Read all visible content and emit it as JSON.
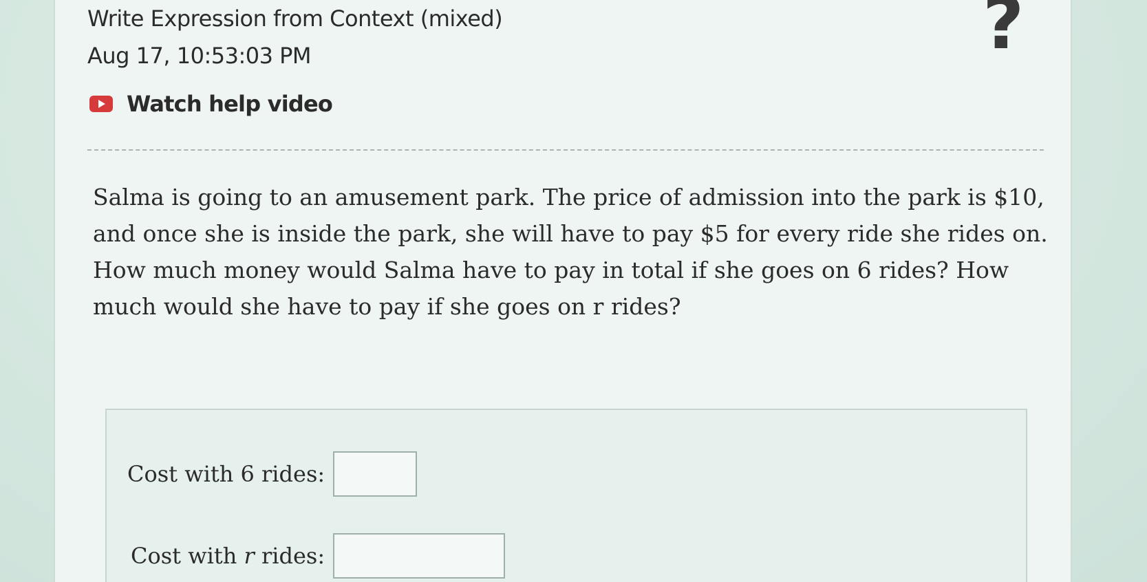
{
  "header": {
    "title": "Write Expression from Context (mixed)",
    "timestamp": "Aug 17, 10:53:03 PM",
    "help_link": "Watch help video",
    "help_icon": "play-video-icon",
    "question_mark": "?"
  },
  "problem": {
    "text": "Salma is going to an amusement park. The price of admission into the park is $10, and once she is inside the park, she will have to pay $5 for every ride she rides on. How much money would Salma have to pay in total if she goes on 6 rides? How much would she have to pay if she goes on r rides?"
  },
  "answers": {
    "cost_6_label": "Cost with 6 rides:",
    "cost_6_value": "",
    "cost_r_label_prefix": "Cost with",
    "cost_r_variable": "r",
    "cost_r_label_suffix": "rides:",
    "cost_r_value": ""
  },
  "colors": {
    "play_icon": "#d63a3a",
    "text": "#2b2b2b",
    "panel_bg": "#eef5f2"
  }
}
